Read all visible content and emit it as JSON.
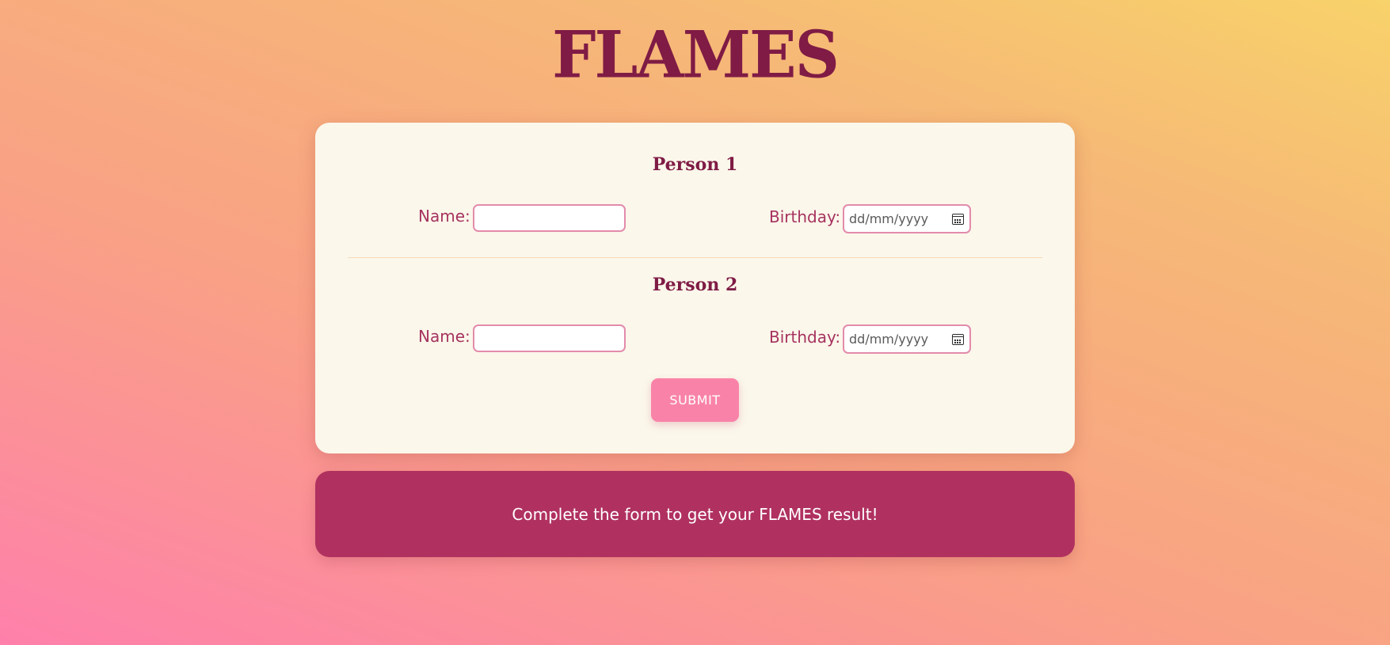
{
  "title": "FLAMES",
  "form": {
    "person1": {
      "heading": "Person 1",
      "name_label": "Name:",
      "name_value": "",
      "birthday_label": "Birthday:",
      "birthday_placeholder": "dd/mm/yyyy",
      "birthday_icon": "calendar-icon"
    },
    "person2": {
      "heading": "Person 2",
      "name_label": "Name:",
      "name_value": "",
      "birthday_label": "Birthday:",
      "birthday_placeholder": "dd/mm/yyyy",
      "birthday_icon": "calendar-icon"
    },
    "submit_label": "SUBMIT"
  },
  "result": {
    "message": "Complete the form to get your FLAMES result!"
  },
  "colors": {
    "title": "#7f1b45",
    "card_bg": "#fbf7eb",
    "label": "#a6335f",
    "input_border": "#e38bab",
    "submit_bg": "#f983a8",
    "result_bg": "#b03160",
    "gradient_start": "#fe80ab",
    "gradient_end": "#f8d26a"
  }
}
